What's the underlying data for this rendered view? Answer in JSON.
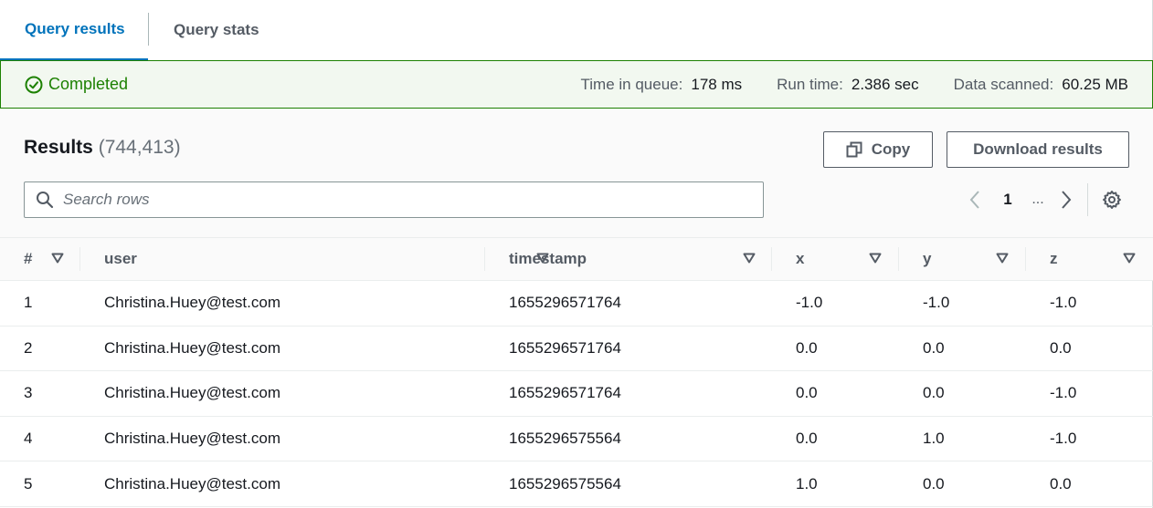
{
  "tabs": {
    "results_label": "Query results",
    "stats_label": "Query stats"
  },
  "status": {
    "state": "Completed",
    "state_color": "#1d8102",
    "metrics": [
      {
        "label": "Time in queue:",
        "value": "178 ms"
      },
      {
        "label": "Run time:",
        "value": "2.386 sec"
      },
      {
        "label": "Data scanned:",
        "value": "60.25 MB"
      }
    ]
  },
  "results": {
    "title": "Results",
    "count": "(744,413)",
    "copy_label": "Copy",
    "download_label": "Download results",
    "search_placeholder": "Search rows",
    "pager": {
      "current": "1",
      "ellipsis": "..."
    }
  },
  "table": {
    "columns": [
      "#",
      "user",
      "timestamp",
      "x",
      "y",
      "z"
    ],
    "rows": [
      [
        "1",
        "Christina.Huey@test.com",
        "1655296571764",
        "-1.0",
        "-1.0",
        "-1.0"
      ],
      [
        "2",
        "Christina.Huey@test.com",
        "1655296571764",
        "0.0",
        "0.0",
        "0.0"
      ],
      [
        "3",
        "Christina.Huey@test.com",
        "1655296571764",
        "0.0",
        "0.0",
        "-1.0"
      ],
      [
        "4",
        "Christina.Huey@test.com",
        "1655296575564",
        "0.0",
        "1.0",
        "-1.0"
      ],
      [
        "5",
        "Christina.Huey@test.com",
        "1655296575564",
        "1.0",
        "0.0",
        "0.0"
      ]
    ]
  },
  "colors": {
    "accent": "#0073bb",
    "success": "#1d8102",
    "border": "#eaeded"
  }
}
